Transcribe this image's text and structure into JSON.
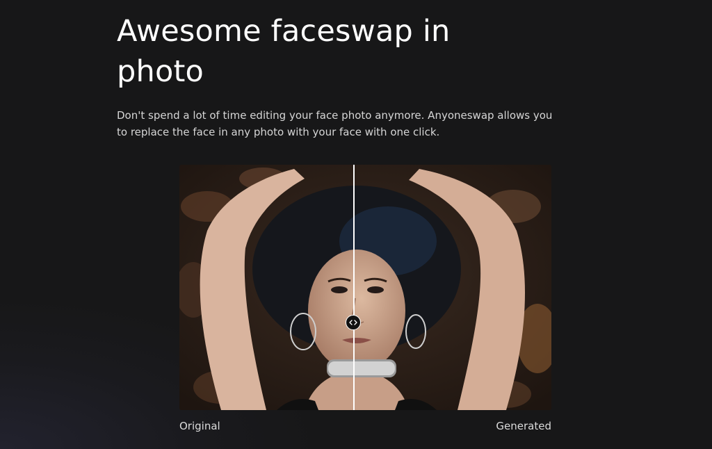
{
  "hero": {
    "title": "Awesome faceswap in photo",
    "description": "Don't spend a lot of time editing your face photo anymore. Anyoneswap allows you to replace the face in any photo with your face with one click."
  },
  "comparison": {
    "split_position": 0.47,
    "left_label": "Original",
    "right_label": "Generated",
    "handle_icon": "left-right-arrows-icon"
  },
  "colors": {
    "background": "#171718",
    "text": "#ffffff",
    "muted_text": "#d6d6d6",
    "divider": "#ffffff"
  }
}
